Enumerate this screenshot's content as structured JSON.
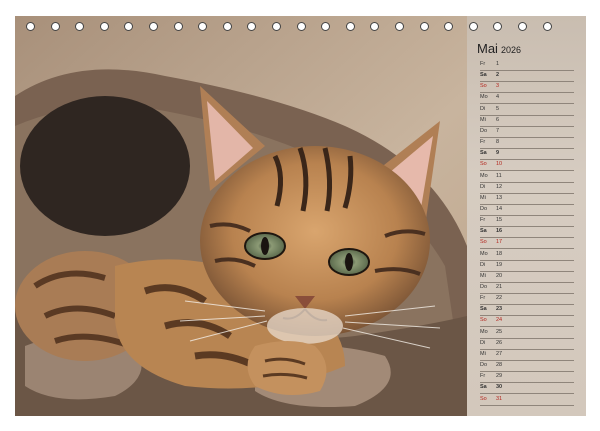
{
  "calendar": {
    "month": "Mai",
    "year": "2026",
    "days": [
      {
        "wd": "Fr",
        "d": "1",
        "type": "weekday"
      },
      {
        "wd": "Sa",
        "d": "2",
        "type": "sat"
      },
      {
        "wd": "So",
        "d": "3",
        "type": "sun"
      },
      {
        "wd": "Mo",
        "d": "4",
        "type": "weekday"
      },
      {
        "wd": "Di",
        "d": "5",
        "type": "weekday"
      },
      {
        "wd": "Mi",
        "d": "6",
        "type": "weekday"
      },
      {
        "wd": "Do",
        "d": "7",
        "type": "weekday"
      },
      {
        "wd": "Fr",
        "d": "8",
        "type": "weekday"
      },
      {
        "wd": "Sa",
        "d": "9",
        "type": "sat"
      },
      {
        "wd": "So",
        "d": "10",
        "type": "sun"
      },
      {
        "wd": "Mo",
        "d": "11",
        "type": "weekday"
      },
      {
        "wd": "Di",
        "d": "12",
        "type": "weekday"
      },
      {
        "wd": "Mi",
        "d": "13",
        "type": "weekday"
      },
      {
        "wd": "Do",
        "d": "14",
        "type": "weekday"
      },
      {
        "wd": "Fr",
        "d": "15",
        "type": "weekday"
      },
      {
        "wd": "Sa",
        "d": "16",
        "type": "sat"
      },
      {
        "wd": "So",
        "d": "17",
        "type": "sun"
      },
      {
        "wd": "Mo",
        "d": "18",
        "type": "weekday"
      },
      {
        "wd": "Di",
        "d": "19",
        "type": "weekday"
      },
      {
        "wd": "Mi",
        "d": "20",
        "type": "weekday"
      },
      {
        "wd": "Do",
        "d": "21",
        "type": "weekday"
      },
      {
        "wd": "Fr",
        "d": "22",
        "type": "weekday"
      },
      {
        "wd": "Sa",
        "d": "23",
        "type": "sat"
      },
      {
        "wd": "So",
        "d": "24",
        "type": "sun"
      },
      {
        "wd": "Mo",
        "d": "25",
        "type": "weekday"
      },
      {
        "wd": "Di",
        "d": "26",
        "type": "weekday"
      },
      {
        "wd": "Mi",
        "d": "27",
        "type": "weekday"
      },
      {
        "wd": "Do",
        "d": "28",
        "type": "weekday"
      },
      {
        "wd": "Fr",
        "d": "29",
        "type": "weekday"
      },
      {
        "wd": "Sa",
        "d": "30",
        "type": "sat"
      },
      {
        "wd": "So",
        "d": "31",
        "type": "sun"
      }
    ]
  },
  "colors": {
    "sunday": "#b3261e",
    "panel": "#d3c8bc",
    "rule": "#8f857b"
  },
  "binding": {
    "hole_count": 22
  }
}
